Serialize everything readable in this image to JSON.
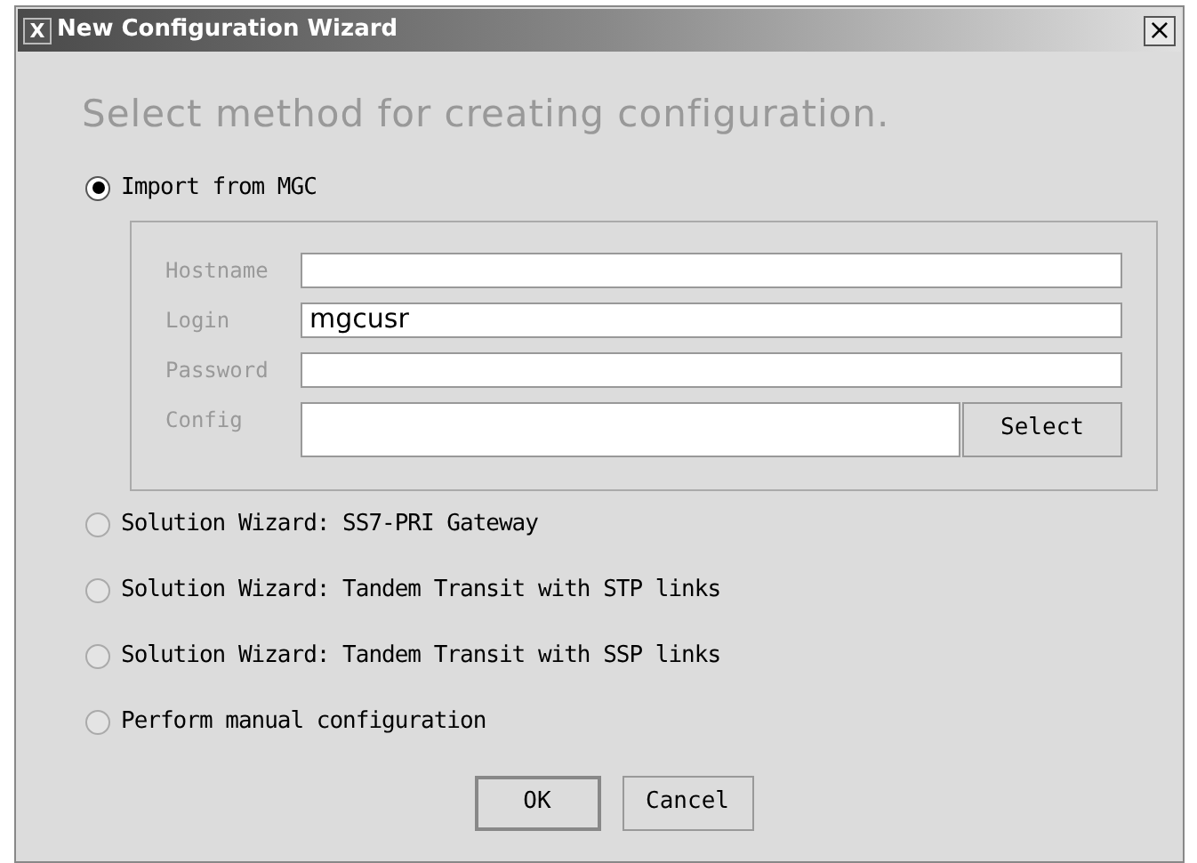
{
  "window": {
    "title": "New Configuration Wizard",
    "close": "×",
    "icon": "X"
  },
  "heading": "Select method for creating configuration.",
  "options": [
    {
      "label": "Import from MGC",
      "selected": true
    },
    {
      "label": "Solution Wizard: SS7-PRI Gateway",
      "selected": false
    },
    {
      "label": "Solution Wizard: Tandem Transit with STP links",
      "selected": false
    },
    {
      "label": "Solution Wizard: Tandem Transit with SSP links",
      "selected": false
    },
    {
      "label": "Perform manual configuration",
      "selected": false
    }
  ],
  "import_fields": [
    {
      "label": "Hostname"
    },
    {
      "label": "Login",
      "value": "mgcusr"
    },
    {
      "label": "Password"
    },
    {
      "label": "Config",
      "button": "Select"
    }
  ],
  "buttons": [
    "OK",
    "Cancel"
  ]
}
